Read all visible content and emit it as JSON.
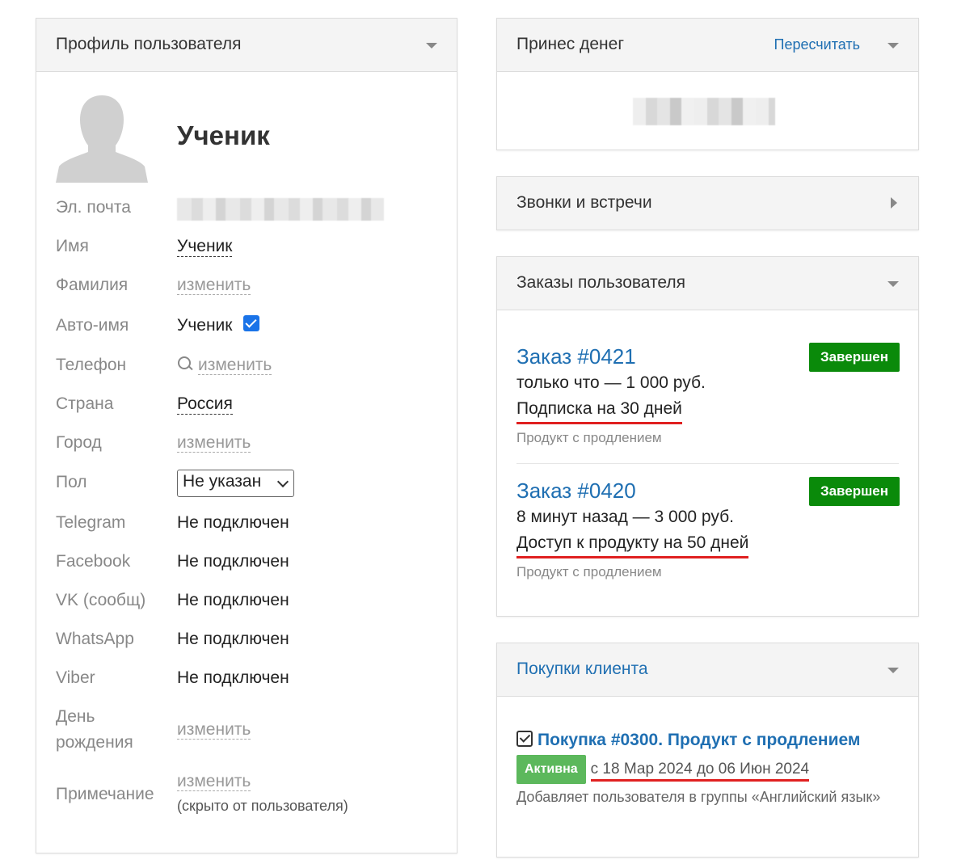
{
  "profile": {
    "title": "Профиль пользователя",
    "name": "Ученик",
    "fields": {
      "email_label": "Эл. почта",
      "firstname_label": "Имя",
      "firstname_value": "Ученик",
      "lastname_label": "Фамилия",
      "lastname_value": "изменить",
      "autoname_label": "Авто-имя",
      "autoname_value": "Ученик",
      "phone_label": "Телефон",
      "phone_value": "изменить",
      "country_label": "Страна",
      "country_value": "Россия",
      "city_label": "Город",
      "city_value": "изменить",
      "gender_label": "Пол",
      "gender_value": "Не указан",
      "telegram_label": "Telegram",
      "telegram_value": "Не подключен",
      "facebook_label": "Facebook",
      "facebook_value": "Не подключен",
      "vk_label": "VK (сообщ)",
      "vk_value": "Не подключен",
      "whatsapp_label": "WhatsApp",
      "whatsapp_value": "Не подключен",
      "viber_label": "Viber",
      "viber_value": "Не подключен",
      "birthday_label_1": "День",
      "birthday_label_2": "рождения",
      "birthday_value": "изменить",
      "note_label": "Примечание",
      "note_value": "изменить",
      "note_sub": "(скрыто от пользователя)"
    }
  },
  "money": {
    "title": "Принес денег",
    "recalc": "Пересчитать"
  },
  "calls": {
    "title": "Звонки и встречи"
  },
  "orders": {
    "title": "Заказы пользователя",
    "items": [
      {
        "title": "Заказ #0421",
        "meta": "только что — 1 000 руб.",
        "product": "Подписка на 30 дней",
        "type": "Продукт с продлением",
        "status": "Завершен"
      },
      {
        "title": "Заказ #0420",
        "meta": "8 минут назад — 3 000 руб.",
        "product": "Доступ к продукту на 50 дней",
        "type": "Продукт с продлением",
        "status": "Завершен"
      }
    ]
  },
  "purchases": {
    "title": "Покупки клиента",
    "item": {
      "title": "Покупка #0300. Продукт с продлением",
      "status": "Активна",
      "period": "с 18 Мар 2024 до 06 Июн 2024",
      "description": "Добавляет пользователя в группы «Английский язык»"
    }
  },
  "colors": {
    "link": "#1f6fb2",
    "done_badge": "#0a8a0a",
    "active_badge": "#5cb85c",
    "underline_red": "#e02020",
    "checkbox": "#1a73e8"
  }
}
